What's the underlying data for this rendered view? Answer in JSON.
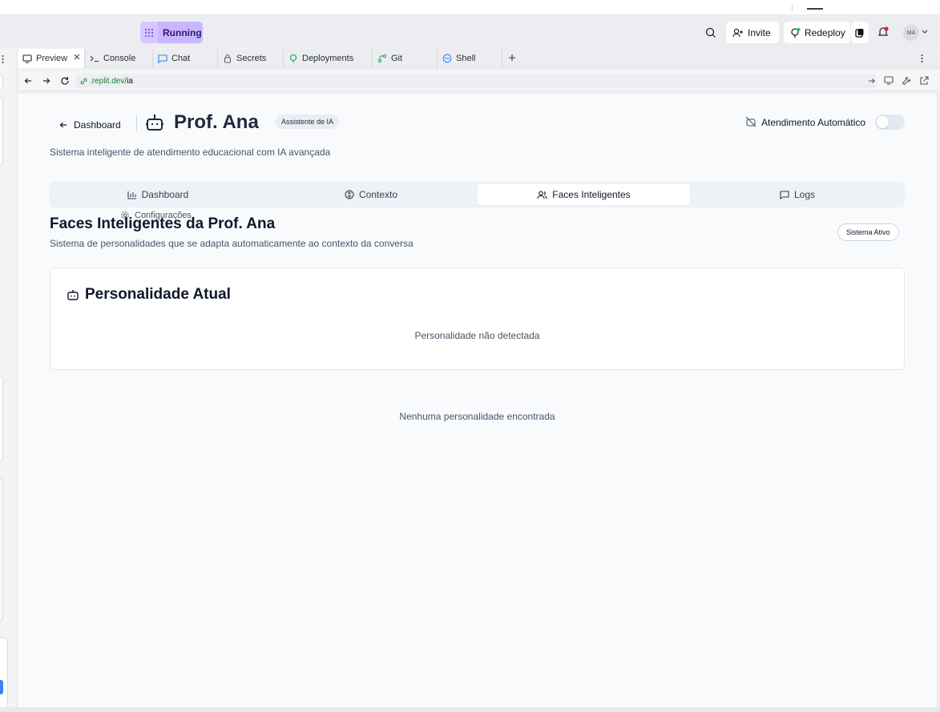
{
  "header": {
    "status": "Running",
    "invite": "Invite",
    "redeploy": "Redeploy",
    "avatar_initials": "MA"
  },
  "tabs": [
    {
      "label": "Preview",
      "icon": "monitor-icon"
    },
    {
      "label": "Console",
      "icon": "terminal-icon"
    },
    {
      "label": "Chat",
      "icon": "chat-icon"
    },
    {
      "label": "Secrets",
      "icon": "lock-icon"
    },
    {
      "label": "Deployments",
      "icon": "deploy-icon"
    },
    {
      "label": "Git",
      "icon": "git-icon"
    },
    {
      "label": "Shell",
      "icon": "shell-icon"
    }
  ],
  "address": {
    "domain": ".replit.dev/",
    "path": "ia"
  },
  "page": {
    "back_label": "Dashboard",
    "title": "Prof. Ana",
    "badge": "Assistente de IA",
    "auto_label": "Atendimento Automático",
    "description": "Sistema inteligente de atendimento educacional com IA avançada"
  },
  "subnav": [
    {
      "label": "Dashboard",
      "icon": "bar-chart-icon"
    },
    {
      "label": "Contexto",
      "icon": "brain-icon"
    },
    {
      "label": "Faces Inteligentes",
      "icon": "users-icon"
    },
    {
      "label": "Logs",
      "icon": "message-icon"
    },
    {
      "label": "Configurações",
      "icon": "gear-icon"
    }
  ],
  "section": {
    "title": "Faces Inteligentes da Prof. Ana",
    "subtitle": "Sistema de personalidades que se adapta automaticamente ao contexto da conversa",
    "status_badge": "Sistema Ativo"
  },
  "card": {
    "title": "Personalidade Atual",
    "empty": "Personalidade não detectada"
  },
  "empty_list": "Nenhuma personalidade encontrada",
  "colors": {
    "accent": "#c9b6ff",
    "url_green": "#1a7f37",
    "notification": "#e11d48"
  }
}
